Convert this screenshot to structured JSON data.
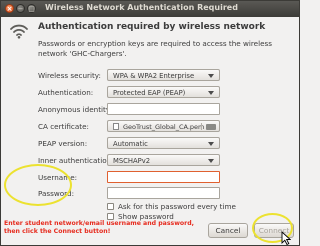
{
  "window": {
    "title": "Wireless Network Authentication Required",
    "close_glyph": "×",
    "min_glyph": "−",
    "max_glyph": "□"
  },
  "heading": "Authentication required by wireless network",
  "description": "Passwords or encryption keys are required to access the wireless network 'GHC-Chargers'.",
  "form": {
    "wireless_security": {
      "label": "Wireless security:",
      "value": "WPA & WPA2 Enterprise"
    },
    "authentication": {
      "label": "Authentication:",
      "value": "Protected EAP (PEAP)"
    },
    "anonymous_identity": {
      "label": "Anonymous identity:",
      "value": ""
    },
    "ca_certificate": {
      "label": "CA certificate:",
      "value": "GeoTrust_Global_CA.pem"
    },
    "peap_version": {
      "label": "PEAP version:",
      "value": "Automatic"
    },
    "inner_authentication": {
      "label": "Inner authentication:",
      "value": "MSCHAPv2"
    },
    "username": {
      "label": "Username:",
      "value": ""
    },
    "password": {
      "label": "Password:",
      "value": ""
    },
    "ask_password": {
      "label": "Ask for this password every time",
      "checked": false
    },
    "show_password": {
      "label": "Show password",
      "checked": false
    }
  },
  "annotation": {
    "note": "Enter student network/email username and password, then click the Connect button!",
    "highlight_color": "#ece230",
    "note_color": "#e62b1e"
  },
  "buttons": {
    "cancel": "Cancel",
    "connect": "Connect"
  },
  "icons": {
    "wireless": "wifi-icon",
    "file": "document-icon",
    "folder": "folder-icon",
    "cursor": "mouse-cursor-icon"
  }
}
